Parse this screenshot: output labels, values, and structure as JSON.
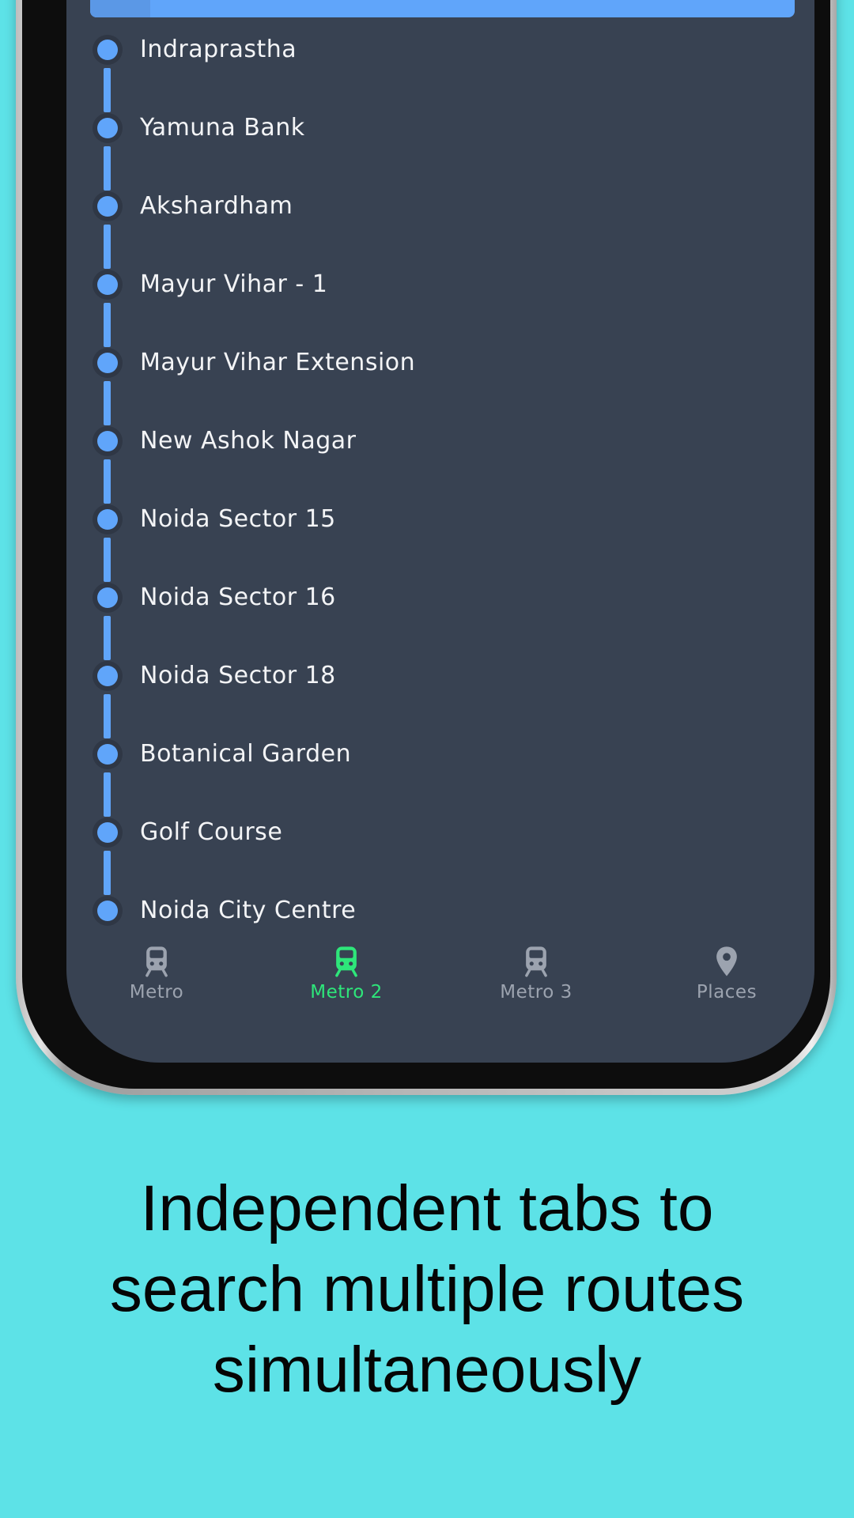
{
  "stations": [
    "Indraprastha",
    "Yamuna Bank",
    "Akshardham",
    "Mayur Vihar - 1",
    "Mayur Vihar Extension",
    "New Ashok Nagar",
    "Noida Sector 15",
    "Noida Sector 16",
    "Noida Sector 18",
    "Botanical Garden",
    "Golf Course",
    "Noida City Centre"
  ],
  "nav": {
    "items": [
      {
        "label": "Metro",
        "icon": "train-icon",
        "active": false
      },
      {
        "label": "Metro 2",
        "icon": "train-icon",
        "active": true
      },
      {
        "label": "Metro 3",
        "icon": "train-icon",
        "active": false
      },
      {
        "label": "Places",
        "icon": "location-pin-icon",
        "active": false
      }
    ]
  },
  "caption": {
    "line1": "Independent tabs to",
    "line2": "search multiple routes",
    "line3": "simultaneously"
  },
  "colors": {
    "background": "#5de2e7",
    "screen": "#384252",
    "route_line": "#60a5fa",
    "active_tab": "#2ee67a",
    "inactive_tab": "#9ca3af"
  }
}
